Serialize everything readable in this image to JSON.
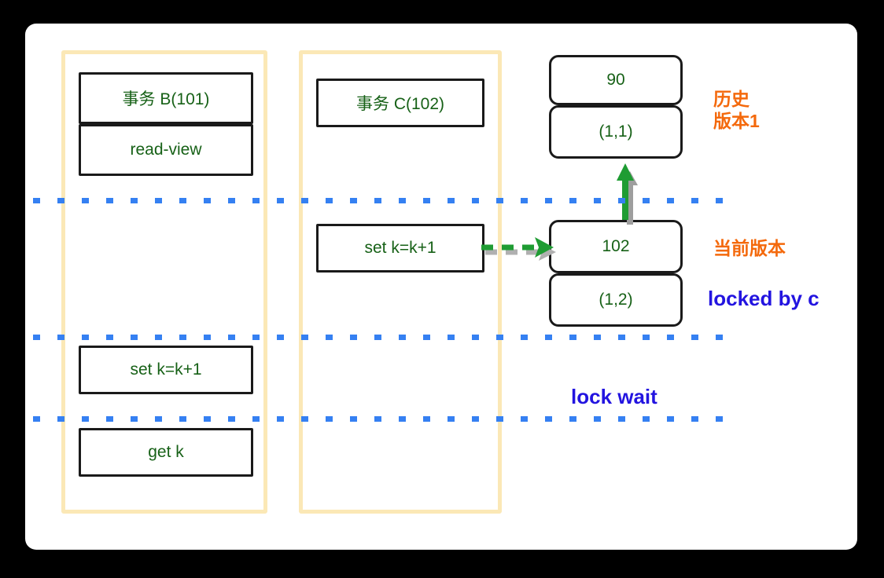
{
  "diagram": {
    "title": "MySQL MVCC transaction timeline sketch",
    "background_color": "#000000",
    "canvas_color": "#ffffff",
    "palette": {
      "box_text_green": "#176117",
      "annotation_orange": "#f4690c",
      "annotation_blue": "#2314e0",
      "dash_blue": "#3580f2",
      "column_cream": "#fbe8b6",
      "sketch_black": "#1a1a1a",
      "arrow_green": "#1f9c33"
    }
  },
  "columns": [
    {
      "name": "transaction-b-column"
    },
    {
      "name": "transaction-c-column"
    }
  ],
  "boxes": {
    "b_header": "事务 B(101)",
    "b_readview": "read-view",
    "b_set": "set k=k+1",
    "b_get": "get k",
    "c_header": "事务 C(102)",
    "c_set": "set k=k+1",
    "v1_trx": "90",
    "v1_row": "(1,1)",
    "v2_trx": "102",
    "v2_row": "(1,2)"
  },
  "annotations": {
    "history_version": "历史\n版本1",
    "current_version": "当前版本",
    "locked_by_c": "locked by c",
    "lock_wait": "lock wait"
  },
  "arrows": [
    {
      "name": "undo-link-arrow",
      "style": "solid",
      "direction": "up",
      "color": "#1f9c33"
    },
    {
      "name": "write-arrow",
      "style": "dashed",
      "direction": "right",
      "color": "#1f9c33"
    }
  ],
  "timeline_rules": [
    {
      "name": "timeline-rule-1"
    },
    {
      "name": "timeline-rule-2"
    },
    {
      "name": "timeline-rule-3"
    }
  ]
}
